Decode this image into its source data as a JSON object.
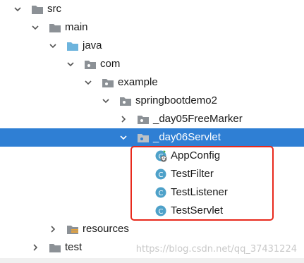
{
  "tree": {
    "items": [
      {
        "label": "src"
      },
      {
        "label": "main"
      },
      {
        "label": "java"
      },
      {
        "label": "com"
      },
      {
        "label": "example"
      },
      {
        "label": "springbootdemo2"
      },
      {
        "label": "_day05FreeMarker"
      },
      {
        "label": "_day06Servlet",
        "selected": true
      },
      {
        "label": "AppConfig"
      },
      {
        "label": "TestFilter"
      },
      {
        "label": "TestListener"
      },
      {
        "label": "TestServlet"
      },
      {
        "label": "resources"
      },
      {
        "label": "test"
      }
    ]
  },
  "watermark": "https://blog.csdn.net/qq_37431224",
  "colors": {
    "selection": "#2f7fd4",
    "highlight_border": "#e8291c",
    "folder": "#8c9196",
    "java_folder": "#6db4dd",
    "class_icon": "#4ea1c9"
  }
}
